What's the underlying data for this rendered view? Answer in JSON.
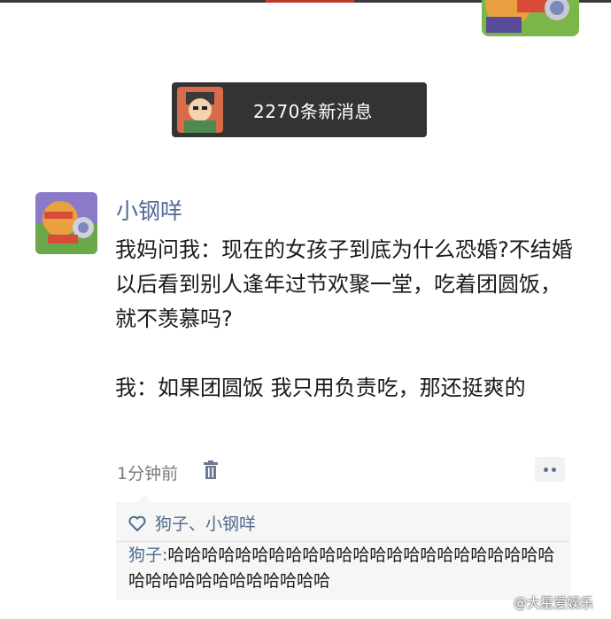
{
  "new_messages": {
    "text": "2270条新消息"
  },
  "post": {
    "username": "小钢咩",
    "content": "我妈问我：现在的女孩子到底为什么恐婚?不结婚以后看到别人逢年过节欢聚一堂，吃着团圆饭，就不羡慕吗?\n\n我：如果团圆饭 我只用负责吃，那还挺爽的",
    "time": "1分钟前"
  },
  "interactions": {
    "likes": "狗子、小钢咩",
    "comments": [
      {
        "name": "狗子",
        "sep": ":",
        "text": "哈哈哈哈哈哈哈哈哈哈哈哈哈哈哈哈哈哈哈哈哈哈哈哈哈哈哈哈哈哈哈哈哈哈哈"
      }
    ]
  },
  "watermark": "@大星爱娱乐",
  "colors": {
    "name": "#4f6a90",
    "banner": "#333333",
    "panel": "#f6f6f6"
  },
  "icons": [
    "cartoon-avatar",
    "trash-icon",
    "more-dots-icon",
    "heart-icon"
  ]
}
